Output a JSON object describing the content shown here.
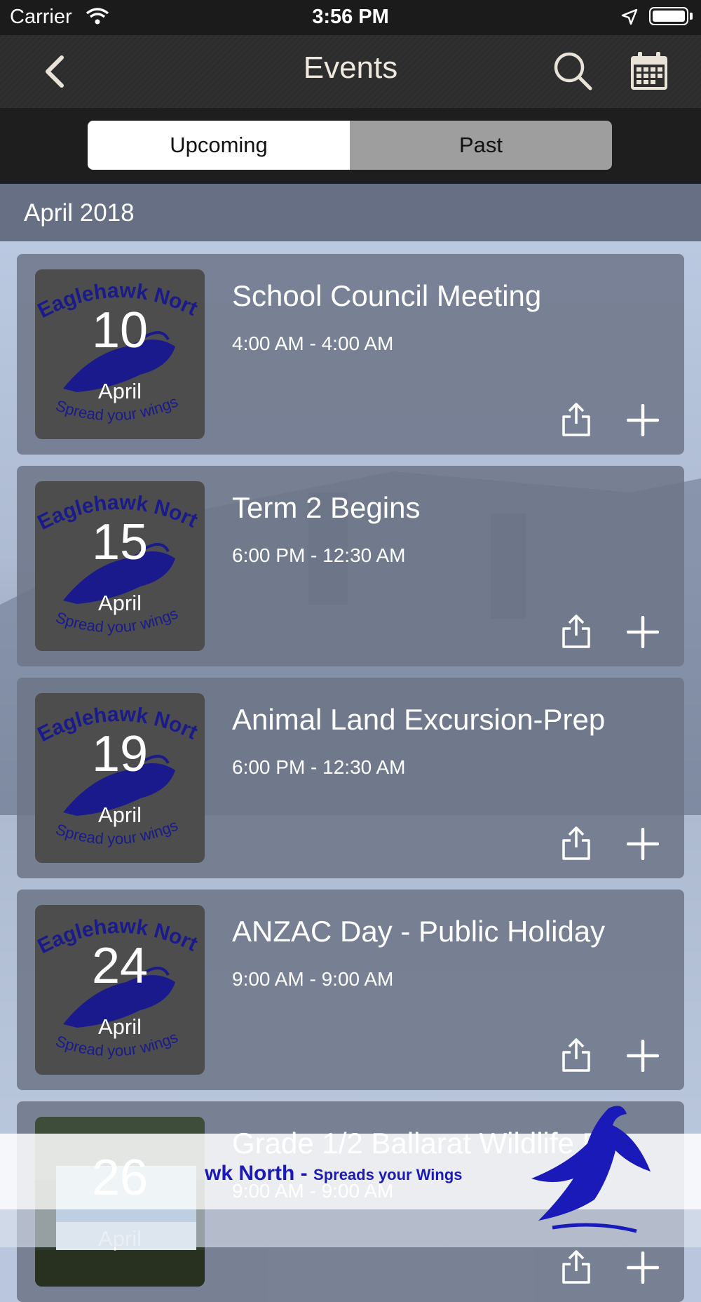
{
  "status_bar": {
    "carrier": "Carrier",
    "time": "3:56 PM"
  },
  "nav": {
    "title": "Events",
    "back_icon": "chevron-left-icon",
    "search_icon": "search-icon",
    "calendar_icon": "calendar-icon"
  },
  "segments": {
    "upcoming": "Upcoming",
    "past": "Past",
    "selected": "Upcoming"
  },
  "month_header": "April 2018",
  "logo_text": {
    "top": "Eaglehawk North",
    "bottom": "Spread your wings"
  },
  "events": [
    {
      "day": "10",
      "month": "April",
      "title": "School Council Meeting",
      "time": "4:00 AM - 4:00 AM"
    },
    {
      "day": "15",
      "month": "April",
      "title": "Term 2 Begins",
      "time": "6:00 PM - 12:30 AM"
    },
    {
      "day": "19",
      "month": "April",
      "title": "Animal Land Excursion-Prep",
      "time": "6:00 PM - 12:30 AM"
    },
    {
      "day": "24",
      "month": "April",
      "title": "ANZAC Day - Public Holiday",
      "time": "9:00 AM - 9:00 AM"
    },
    {
      "day": "26",
      "month": "April",
      "title": "Grade 1/2 Ballarat Wildlife P...",
      "time": "9:00 AM - 9:00 AM"
    }
  ],
  "banner": {
    "name": "wk North -",
    "tagline": "Spreads your Wings"
  },
  "colors": {
    "logo_blue": "#1a1ab8",
    "segment_active": "#ffffff",
    "segment_inactive": "#9e9e9e"
  }
}
